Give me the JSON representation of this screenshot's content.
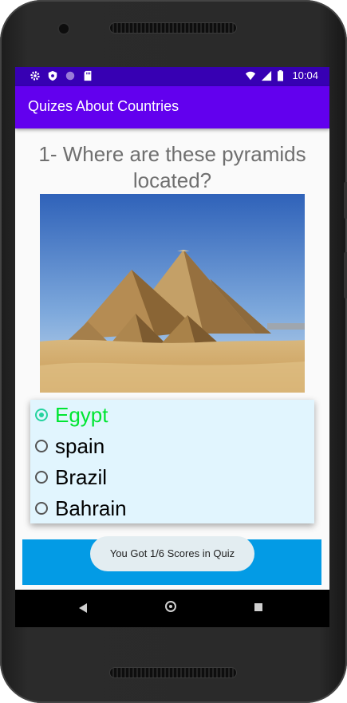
{
  "status_bar": {
    "time": "10:04",
    "left_icons": [
      "gear-icon",
      "shield-icon",
      "circle-icon",
      "sd-card-icon"
    ],
    "right_icons": [
      "wifi-icon",
      "signal-icon",
      "battery-icon"
    ]
  },
  "app_bar": {
    "title": "Quizes About Countries"
  },
  "question": {
    "line1": "1- Where are these pyramids",
    "line2": "located?"
  },
  "image": {
    "subject": "pyramids-of-giza"
  },
  "options": [
    {
      "label": "Egypt",
      "selected": true,
      "correct": true
    },
    {
      "label": "spain",
      "selected": false
    },
    {
      "label": "Brazil",
      "selected": false
    },
    {
      "label": "Bahrain",
      "selected": false
    }
  ],
  "next_button": {
    "icon": "fast-forward-icon"
  },
  "toast": {
    "text": "You Got 1/6 Scores in Quiz"
  },
  "colors": {
    "status_bar": "#3700b3",
    "app_bar": "#6200ee",
    "options_bg": "#e1f5fe",
    "correct_text": "#00e632",
    "radio_checked": "#26d39e",
    "next_bar": "#039be5"
  }
}
